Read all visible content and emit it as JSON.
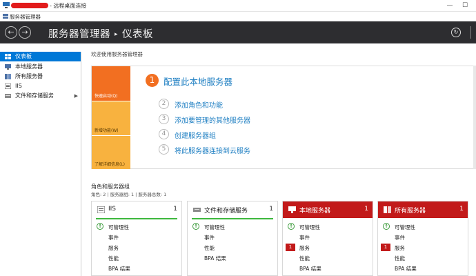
{
  "rdp": {
    "title": "- 远程桌面连接",
    "minimize_glyph": "—",
    "maximize_glyph": "☐"
  },
  "app": {
    "title": "服务器管理器",
    "icon": "server-manager-icon"
  },
  "nav": {
    "breadcrumb_root": "服务器管理器",
    "breadcrumb_sep": "▸",
    "breadcrumb_current": "仪表板",
    "back_glyph": "←",
    "forward_glyph": "→",
    "refresh_glyph": "↻"
  },
  "sidebar": {
    "items": [
      {
        "label": "仪表板",
        "icon": "dashboard-icon",
        "active": true
      },
      {
        "label": "本地服务器",
        "icon": "server-icon"
      },
      {
        "label": "所有服务器",
        "icon": "servers-icon"
      },
      {
        "label": "IIS",
        "icon": "iis-icon"
      },
      {
        "label": "文件和存储服务",
        "icon": "storage-icon",
        "has_children": true,
        "chevron": "▶"
      }
    ]
  },
  "main": {
    "welcome": "欢迎使用服务器管理器",
    "quickstart": {
      "tiles": [
        "快速启动(Q)",
        "新增功能(W)",
        "了解详细信息(L)"
      ],
      "step1": {
        "num": "1",
        "text": "配置此本地服务器"
      },
      "steps": [
        {
          "num": "2",
          "text": "添加角色和功能"
        },
        {
          "num": "3",
          "text": "添加要管理的其他服务器"
        },
        {
          "num": "4",
          "text": "创建服务器组"
        },
        {
          "num": "5",
          "text": "将此服务器连接到云服务"
        }
      ],
      "colors": {
        "tile_primary": "#f26f21",
        "tile_secondary": "#f8b23f",
        "link": "#1d7ec2"
      }
    },
    "roles": {
      "title": "角色和服务器组",
      "subtitle": "角色: 2 | 服务器组: 1 | 服务器总数: 1",
      "cards": [
        {
          "title": "IIS",
          "count": "1",
          "alert": false,
          "icon": "iis-icon",
          "rows": [
            "可管理性",
            "事件",
            "服务",
            "性能",
            "BPA 结果"
          ],
          "ok_glyph": "↑"
        },
        {
          "title": "文件和存储服务",
          "count": "1",
          "alert": false,
          "icon": "storage-icon",
          "rows": [
            "可管理性",
            "事件",
            "性能",
            "BPA 结果"
          ],
          "ok_glyph": "↑"
        },
        {
          "title": "本地服务器",
          "count": "1",
          "alert": true,
          "icon": "server-icon",
          "rows": [
            "可管理性",
            "事件",
            "服务",
            "性能",
            "BPA 结果"
          ],
          "ok_glyph": "↑",
          "service_alert": "1"
        },
        {
          "title": "所有服务器",
          "count": "1",
          "alert": true,
          "icon": "servers-icon",
          "rows": [
            "可管理性",
            "事件",
            "服务",
            "性能",
            "BPA 结果"
          ],
          "ok_glyph": "↑",
          "service_alert": "1"
        }
      ],
      "colors": {
        "alert": "#c21a1a",
        "ok": "#3db83d"
      }
    }
  }
}
